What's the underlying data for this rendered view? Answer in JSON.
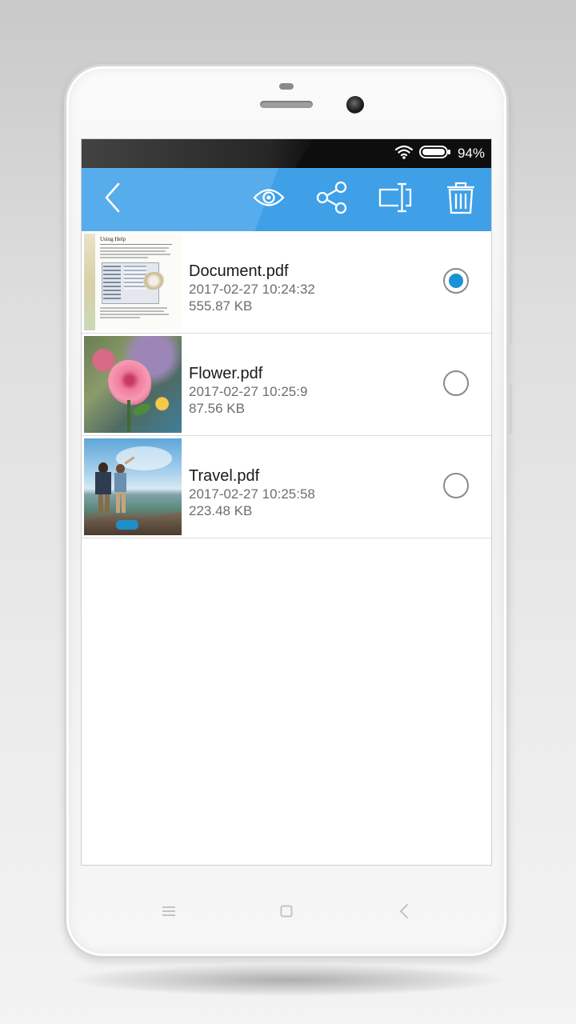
{
  "status_bar": {
    "battery_percent": "94%",
    "icons": [
      "wifi-icon",
      "battery-icon"
    ]
  },
  "toolbar": {
    "actions": [
      {
        "name": "back",
        "icon": "chevron-left-icon"
      },
      {
        "name": "preview",
        "icon": "eye-icon"
      },
      {
        "name": "share",
        "icon": "share-icon"
      },
      {
        "name": "rename",
        "icon": "rename-icon"
      },
      {
        "name": "delete",
        "icon": "trash-icon"
      }
    ]
  },
  "files": [
    {
      "name": "Document.pdf",
      "date": "2017-02-27 10:24:32",
      "size": "555.87 KB",
      "selected": true,
      "thumbnail_title": "Using Help"
    },
    {
      "name": "Flower.pdf",
      "date": "2017-02-27 10:25:9",
      "size": "87.56 KB",
      "selected": false
    },
    {
      "name": "Travel.pdf",
      "date": "2017-02-27 10:25:58",
      "size": "223.48 KB",
      "selected": false
    }
  ],
  "nav_bar": {
    "keys": [
      "menu-icon",
      "home-icon",
      "back-icon"
    ]
  },
  "colors": {
    "toolbar": "#3fa0e8",
    "radio_selected": "#1a93d6",
    "status_bar": "#0e0e0e"
  }
}
